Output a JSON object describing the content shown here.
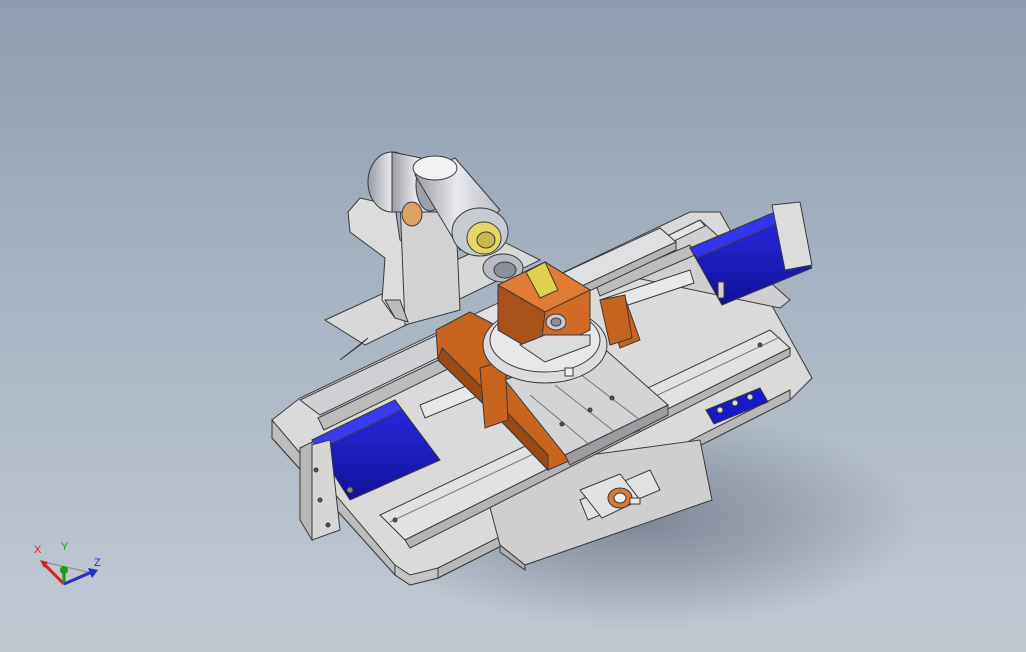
{
  "viewport": {
    "background_top": "#8e9eb0",
    "background_bottom": "#c1c9d3"
  },
  "colors": {
    "frame_gray": "#dcdcdc",
    "frame_edge": "#3a3a3a",
    "rail_gray": "#c8c8cc",
    "motor_blue": "#1616c8",
    "bracket_orange": "#c8641e",
    "coupling_yellow": "#e0d060",
    "bearing_silver": "#d0d2da"
  },
  "triad": {
    "x_label": "X",
    "y_label": "Y",
    "z_label": "Z",
    "x_color": "#d22323",
    "y_color": "#1d9a1d",
    "z_color": "#2630c9"
  }
}
